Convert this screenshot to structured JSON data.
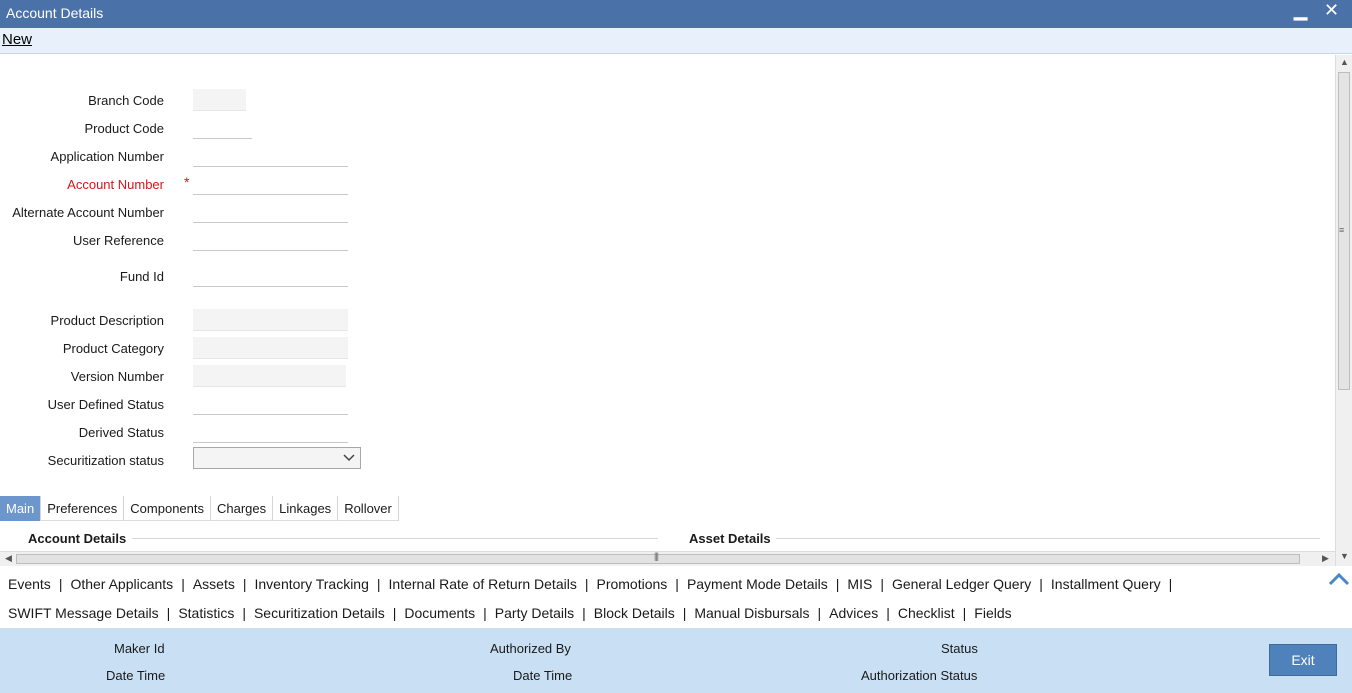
{
  "window": {
    "title": "Account Details",
    "minimize": "▁",
    "close": "✕"
  },
  "toolbar": {
    "new_label": "New"
  },
  "form": {
    "branch_code": {
      "label": "Branch Code",
      "value": ""
    },
    "product_code": {
      "label": "Product Code",
      "value": ""
    },
    "application_number": {
      "label": "Application Number",
      "value": ""
    },
    "account_number": {
      "label": "Account Number",
      "required_mark": "*",
      "value": ""
    },
    "alternate_account_number": {
      "label": "Alternate Account Number",
      "value": ""
    },
    "user_reference": {
      "label": "User Reference",
      "value": ""
    },
    "fund_id": {
      "label": "Fund Id",
      "value": ""
    },
    "product_description": {
      "label": "Product Description",
      "value": ""
    },
    "product_category": {
      "label": "Product Category",
      "value": ""
    },
    "version_number": {
      "label": "Version Number",
      "value": ""
    },
    "user_defined_status": {
      "label": "User Defined Status",
      "value": ""
    },
    "derived_status": {
      "label": "Derived Status",
      "value": ""
    },
    "securitization_status": {
      "label": "Securitization status",
      "value": ""
    }
  },
  "tabs": [
    "Main",
    "Preferences",
    "Components",
    "Charges",
    "Linkages",
    "Rollover"
  ],
  "active_tab": "Main",
  "sections": {
    "left": "Account Details",
    "right": "Asset Details"
  },
  "links_row1": [
    "Events",
    "Other Applicants",
    "Assets",
    "Inventory Tracking",
    "Internal Rate of Return Details",
    "Promotions",
    "Payment Mode Details",
    "MIS",
    "General Ledger Query",
    "Installment Query"
  ],
  "links_row2": [
    "SWIFT Message Details",
    "Statistics",
    "Securitization Details",
    "Documents",
    "Party Details",
    "Block Details",
    "Manual Disbursals",
    "Advices",
    "Checklist",
    "Fields"
  ],
  "footer": {
    "maker_id": "Maker Id",
    "date_time": "Date Time",
    "authorized_by": "Authorized By",
    "date_time_2": "Date Time",
    "status": "Status",
    "authorization_status": "Authorization Status",
    "exit_label": "Exit"
  },
  "colors": {
    "titlebar": "#4a72a8",
    "active_tab": "#6d96cc",
    "footer": "#c9dff3",
    "required": "#d01818",
    "exit_button": "#4f82ba"
  }
}
